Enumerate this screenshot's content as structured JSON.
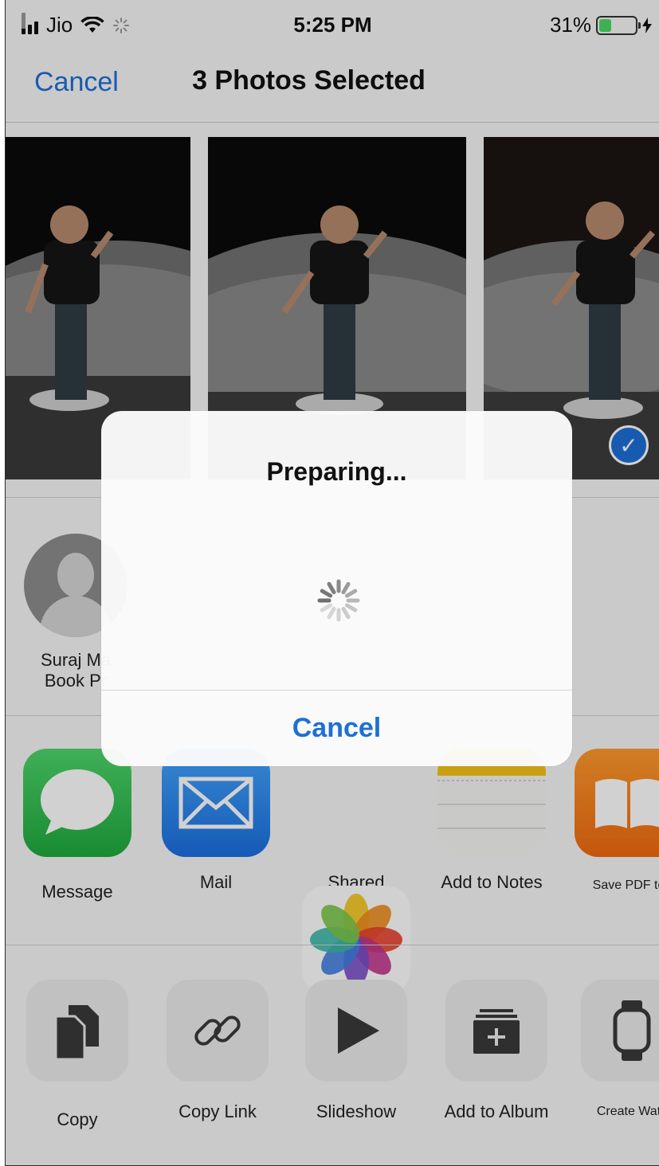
{
  "status": {
    "carrier": "Jio",
    "time": "5:25 PM",
    "battery": "31%",
    "battery_level": 0.31
  },
  "nav": {
    "cancel_label": "Cancel",
    "title": "3 Photos Selected"
  },
  "airdrop": {
    "contact_name": "Suraj Ma\nBook Pr"
  },
  "apps": [
    {
      "label": "Message",
      "icon": "message-icon"
    },
    {
      "label": "Mail",
      "icon": "mail-icon"
    },
    {
      "label": "Shared\nAlbums",
      "icon": "shared-albums-icon"
    },
    {
      "label": "Add to Notes",
      "icon": "notes-icon"
    },
    {
      "label": "Save PDF to",
      "icon": "books-icon"
    }
  ],
  "actions": [
    {
      "label": "Copy",
      "icon": "copy-icon"
    },
    {
      "label": "Copy Link",
      "icon": "link-icon"
    },
    {
      "label": "Slideshow",
      "icon": "play-icon"
    },
    {
      "label": "Add to Album",
      "icon": "add-album-icon"
    },
    {
      "label": "Create Watc",
      "icon": "watch-icon"
    }
  ],
  "alert": {
    "title": "Preparing...",
    "cancel_label": "Cancel"
  },
  "colors": {
    "accent": "#1d6fd8",
    "battery": "#4cd964"
  }
}
